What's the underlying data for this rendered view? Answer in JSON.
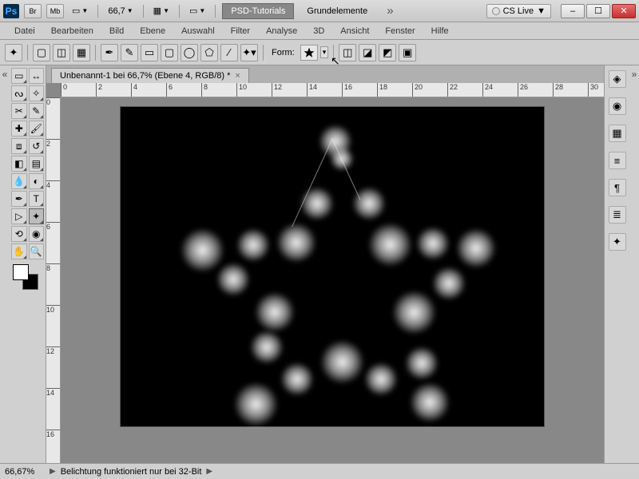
{
  "title": {
    "br": "Br",
    "mb": "Mb",
    "zoom": "66,7",
    "psd_tutorials": "PSD-Tutorials",
    "grundelemente": "Grundelemente",
    "cs_live": "CS Live"
  },
  "menu": {
    "datei": "Datei",
    "bearbeiten": "Bearbeiten",
    "bild": "Bild",
    "ebene": "Ebene",
    "auswahl": "Auswahl",
    "filter": "Filter",
    "analyse": "Analyse",
    "d3d": "3D",
    "ansicht": "Ansicht",
    "fenster": "Fenster",
    "hilfe": "Hilfe"
  },
  "options": {
    "form_label": "Form:"
  },
  "document": {
    "tab": "Unbenannt-1 bei 66,7% (Ebene 4, RGB/8) *"
  },
  "ruler_h": [
    "0",
    "2",
    "4",
    "6",
    "8",
    "10",
    "12",
    "14",
    "16",
    "18",
    "20",
    "22",
    "24",
    "26",
    "28",
    "30"
  ],
  "ruler_v": [
    "0",
    "2",
    "4",
    "6",
    "8",
    "10",
    "12",
    "14",
    "16"
  ],
  "status": {
    "zoom": "66,67%",
    "msg": "Belichtung funktioniert nur bei 32-Bit"
  },
  "tools": [
    [
      "move",
      "marquee"
    ],
    [
      "lasso",
      "wand"
    ],
    [
      "crop",
      "eyedrop"
    ],
    [
      "heal",
      "brush"
    ],
    [
      "stamp",
      "history"
    ],
    [
      "eraser",
      "gradient"
    ],
    [
      "blur",
      "dodge"
    ],
    [
      "pen",
      "type"
    ],
    [
      "path-sel",
      "shape"
    ],
    [
      "hand",
      "zoom"
    ],
    [
      "3d-rotate",
      "3d-orbit"
    ]
  ],
  "panels": [
    "layers",
    "color",
    "swatches",
    "adjustments",
    "character",
    "paragraph",
    "tool-presets"
  ]
}
